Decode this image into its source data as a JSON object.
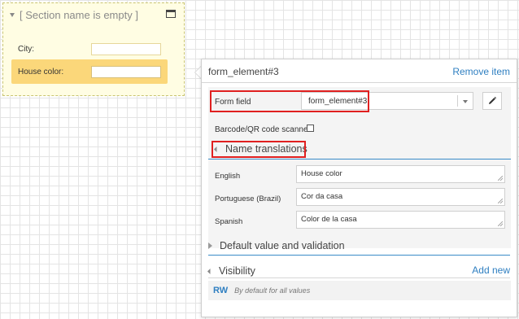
{
  "canvas": {
    "section": {
      "title": "[ Section name is empty ]",
      "fields": [
        {
          "label": "City:"
        },
        {
          "label": "House color:"
        }
      ]
    }
  },
  "panel": {
    "title": "form_element#3",
    "remove_label": "Remove item",
    "form_field": {
      "label": "Form field",
      "value": "form_element#3"
    },
    "barcode_label": "Barcode/QR code scanner",
    "barcode_checked": false,
    "name_translations": {
      "heading": "Name translations",
      "rows": [
        {
          "language": "English",
          "value": "House color"
        },
        {
          "language": "Portuguese (Brazil)",
          "value": "Cor da casa"
        },
        {
          "language": "Spanish",
          "value": "Color de la casa"
        }
      ]
    },
    "default_value_heading": "Default value and validation",
    "visibility": {
      "heading": "Visibility",
      "add_label": "Add new",
      "badge": "RW",
      "description": "By default for all values"
    }
  },
  "colors": {
    "accent": "#2f7fc1",
    "highlight": "#e02020",
    "section_bg": "#fffde3",
    "selected_row": "#fbd77a"
  }
}
